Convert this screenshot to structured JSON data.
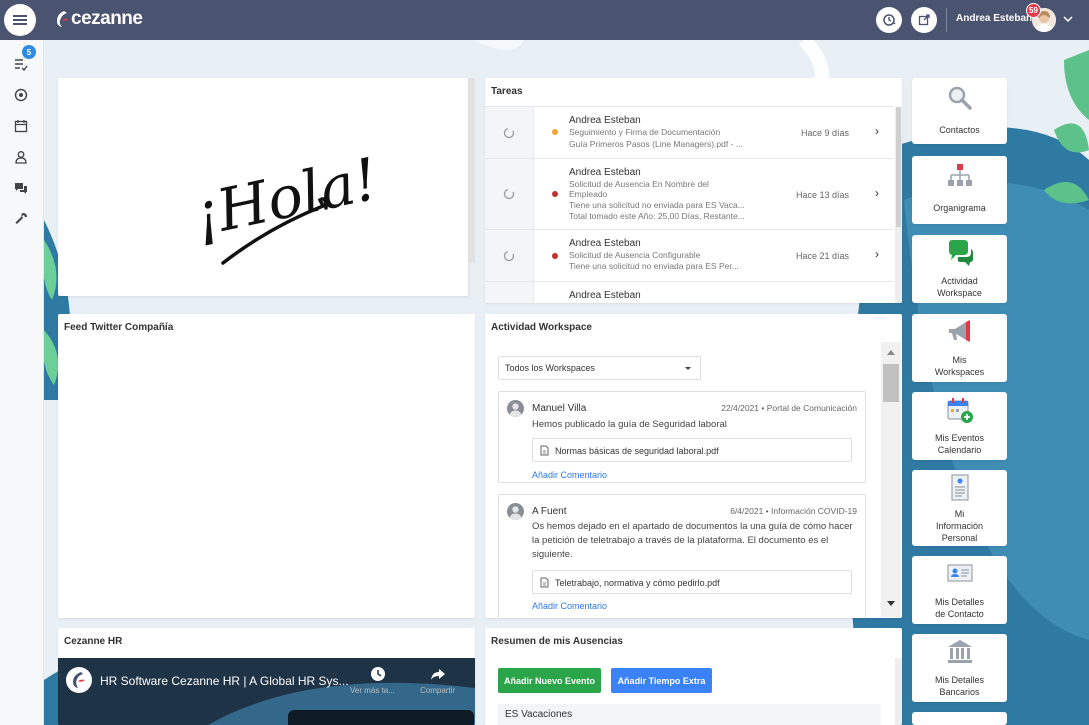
{
  "header": {
    "logo_text": "cezanne",
    "user_name": "Andrea Esteban",
    "notification_count": "59"
  },
  "sidebar": {
    "tasks_badge": "5"
  },
  "hola_card": {
    "text": "¡Hola!"
  },
  "twitter": {
    "title": "Feed Twitter Compañía"
  },
  "video_card": {
    "title": "Cezanne HR",
    "video_title": "HR Software Cezanne HR | A Global HR Sys...",
    "watch_later": "Ver más ta...",
    "share": "Compartir"
  },
  "tasks": {
    "title": "Tareas",
    "items": [
      {
        "name": "Andrea Esteban",
        "line1": "Seguimiento y Firma de Documentación",
        "line2": "Guía Primeros Pasos (Line Managers).pdf - ...",
        "line3": "",
        "line4": "",
        "time": "Hace 9 días",
        "color": "#f2a33a"
      },
      {
        "name": "Andrea Esteban",
        "line1": "Solicitud de Ausencia En Nombre del",
        "line2": "Empleado",
        "line3": "Tiene una solicitud no enviada para ES Vaca...",
        "line4": "Total tomado este Año: 25,00 Días, Restante...",
        "time": "Hace 13 días",
        "color": "#c0302f"
      },
      {
        "name": "Andrea Esteban",
        "line1": "Solicitud de Ausencia Configurable",
        "line2": "Tiene una solicitud no enviada para ES Per...",
        "line3": "",
        "line4": "",
        "time": "Hace 21 días",
        "color": "#c0302f"
      },
      {
        "name": "Andrea Esteban"
      }
    ]
  },
  "workspace": {
    "title": "Actividad Workspace",
    "select_value": "Todos los Workspaces",
    "posts": [
      {
        "author": "Manuel Villa",
        "date": "22/4/2021",
        "workspace": "Portal de Comunicación",
        "text": "Hemos publicado la guía de Seguridad laboral",
        "file": "Normas básicas de seguridad laboral.pdf",
        "comment": "Añadir Comentario"
      },
      {
        "author": "A Fuent",
        "date": "6/4/2021",
        "workspace": "Información COVID-19",
        "text": "Os hemos dejado en el apartado de documentos la una guía de cómo hacer la petición de teletrabajo a través de la plataforma. El documento es el siguiente.",
        "file": "Teletrabajo, normativa y cómo pedirlo.pdf",
        "comment": "Añadir Comentario"
      }
    ]
  },
  "absences": {
    "title": "Resumen de mis Ausencias",
    "add_event": "Añadir Nuevo Evento",
    "add_overtime": "Añadir Tiempo Extra",
    "row": "ES Vacaciones"
  },
  "quick_links": [
    {
      "label_line1": "Contactos",
      "label_line2": "",
      "label_line3": ""
    },
    {
      "label_line1": "Organigrama",
      "label_line2": "",
      "label_line3": ""
    },
    {
      "label_line1": "Actividad",
      "label_line2": "Workspace",
      "label_line3": ""
    },
    {
      "label_line1": "Mis",
      "label_line2": "Workspaces",
      "label_line3": ""
    },
    {
      "label_line1": "Mis Eventos",
      "label_line2": "Calendario",
      "label_line3": ""
    },
    {
      "label_line1": "Mi",
      "label_line2": "Información",
      "label_line3": "Personal"
    },
    {
      "label_line1": "Mis Detalles",
      "label_line2": "de Contacto",
      "label_line3": ""
    },
    {
      "label_line1": "Mis Detalles",
      "label_line2": "Bancarios",
      "label_line3": ""
    }
  ],
  "colors": {
    "topbar": "#4a5370",
    "accent_blue": "#2d7be0",
    "green_button": "#2aa54a",
    "blue_button": "#3b82f6",
    "badge_red": "#e03a4b"
  }
}
